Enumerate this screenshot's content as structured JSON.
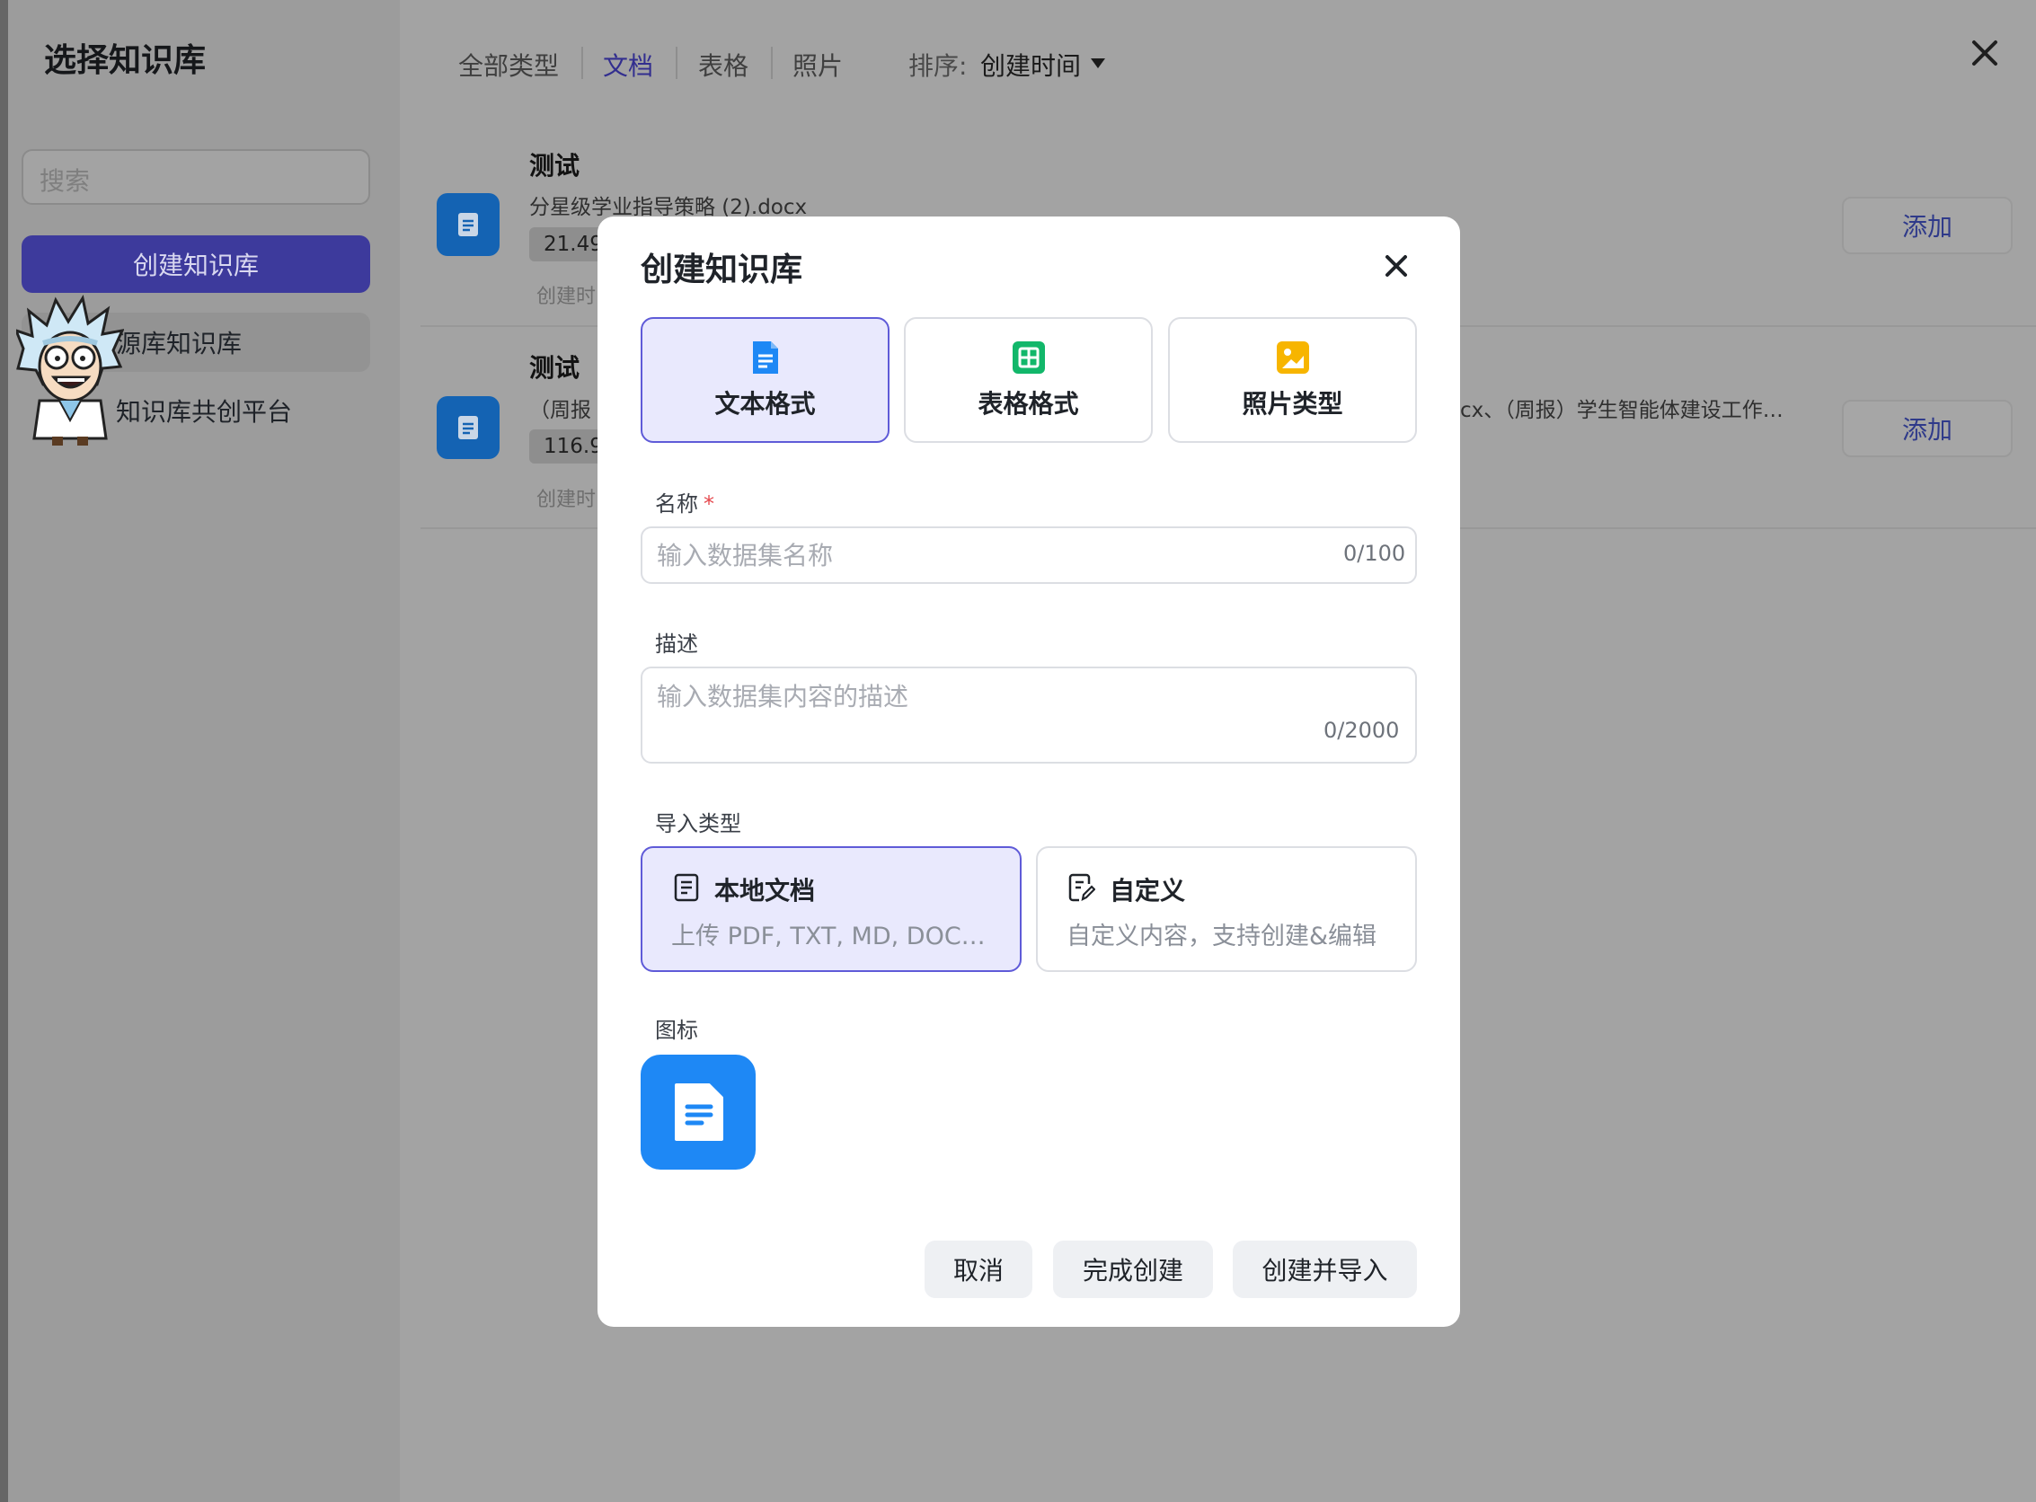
{
  "sidebar": {
    "title": "选择知识库",
    "search_placeholder": "搜索",
    "create_button": "创建知识库",
    "items": [
      {
        "label": "源库知识库",
        "active": true
      },
      {
        "label": "知识库共创平台",
        "active": false
      }
    ]
  },
  "filters": {
    "tabs": [
      {
        "label": "全部类型",
        "active": false
      },
      {
        "label": "文档",
        "active": true
      },
      {
        "label": "表格",
        "active": false
      },
      {
        "label": "照片",
        "active": false
      }
    ],
    "sort_label": "排序:",
    "sort_value": "创建时间"
  },
  "kb_list": [
    {
      "title": "测试",
      "subtitle": "分星级学业指导策略 (2).docx",
      "size": "21.49",
      "time_label": "创建时",
      "add_label": "添加"
    },
    {
      "title": "测试",
      "subtitle_left": "（周报",
      "subtitle_right": "cx、（周报）学生智能体建设工作…",
      "size": "116.9(",
      "time_label": "创建时",
      "add_label": "添加"
    }
  ],
  "dialog": {
    "title": "创建知识库",
    "format_types": [
      {
        "label": "文本格式",
        "icon": "document-icon",
        "selected": true
      },
      {
        "label": "表格格式",
        "icon": "table-icon",
        "selected": false
      },
      {
        "label": "照片类型",
        "icon": "image-icon",
        "selected": false
      }
    ],
    "name_label": "名称",
    "name_required_mark": "*",
    "name_placeholder": "输入数据集名称",
    "name_count": "0/100",
    "desc_label": "描述",
    "desc_placeholder": "输入数据集内容的描述",
    "desc_count": "0/2000",
    "import_label": "导入类型",
    "import_types": [
      {
        "title": "本地文档",
        "desc": "上传 PDF, TXT, MD, DOC…",
        "selected": true
      },
      {
        "title": "自定义",
        "desc": "自定义内容，支持创建&编辑",
        "selected": false
      }
    ],
    "icon_label": "图标",
    "buttons": {
      "cancel": "取消",
      "finish": "完成创建",
      "create_import": "创建并导入"
    }
  },
  "colors": {
    "accent": "#5f5bd8",
    "selected_bg": "#e9e9fd",
    "primary_btn": "#3d3a9c",
    "doc_blue": "#1e88f5",
    "table_green": "#12b76a",
    "image_yellow": "#f7b500"
  }
}
